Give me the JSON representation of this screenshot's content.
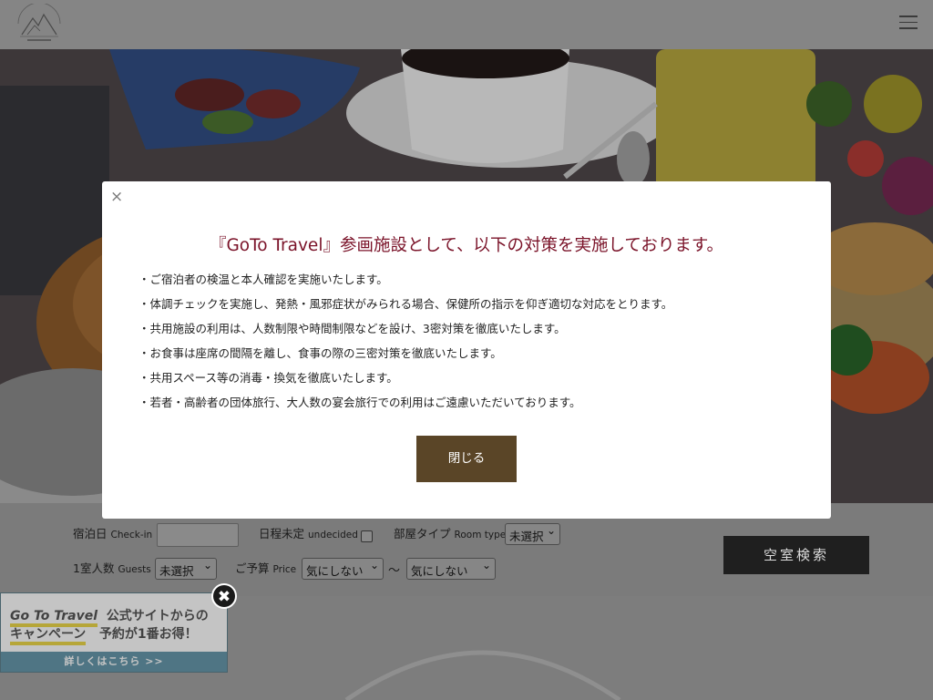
{
  "header": {
    "logo_alt": "BELLE VUE NISHIYAMA",
    "menu_icon": "hamburger-menu-icon"
  },
  "search": {
    "checkin_label": "宿泊日",
    "checkin_sub": "Check-in",
    "undecided_label": "日程未定",
    "undecided_sub": "undecided",
    "roomtype_label": "部屋タイプ",
    "roomtype_sub": "Room type",
    "roomtype_value": "未選択",
    "guests_label": "1室人数",
    "guests_sub": "Guests",
    "guests_value": "未選択",
    "price_label": "ご予算",
    "price_sub": "Price",
    "price_min_value": "気にしない",
    "price_sep": "〜",
    "price_max_value": "気にしない",
    "search_button": "空室検索"
  },
  "banner": {
    "goto_label": "Go To Travel",
    "line1_rest": "公式サイトからの",
    "line2_left": "キャンペーン",
    "line2_right": "予約が1番お得！",
    "link": "詳しくはこちら >>"
  },
  "modal": {
    "close_label": "×",
    "title": "『GoTo Travel』参画施設として、以下の対策を実施しております。",
    "items": [
      "・ご宿泊者の検温と本人確認を実施いたします。",
      "・体調チェックを実施し、発熱・風邪症状がみられる場合、保健所の指示を仰ぎ適切な対応をとります。",
      "・共用施設の利用は、人数制限や時間制限などを設け、3密対策を徹底いたします。",
      "・お食事は座席の間隔を離し、食事の際の三密対策を徹底いたします。",
      "・共用スペース等の消毒・換気を徹底いたします。",
      "・若者・高齢者の団体旅行、大人数の宴会旅行での利用はご遠慮いただいております。"
    ],
    "close_button": "閉じる"
  },
  "colors": {
    "modal_title": "#7a1228",
    "modal_button": "#5a4527",
    "search_button": "#1f1f1f"
  }
}
